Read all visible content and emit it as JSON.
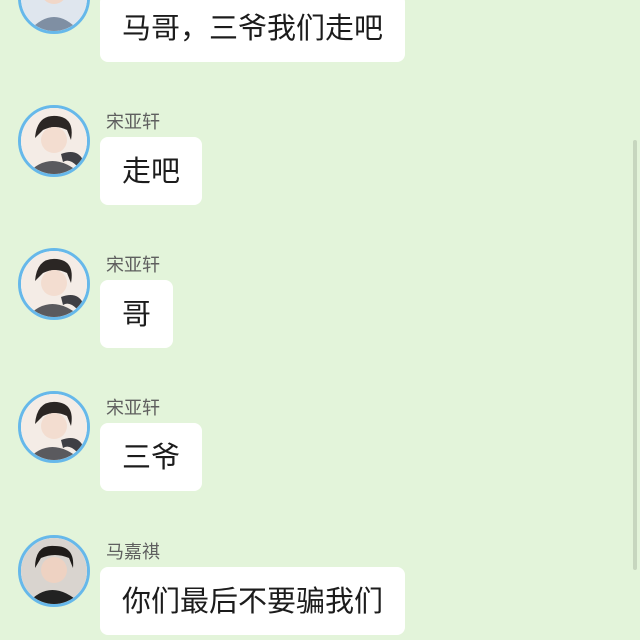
{
  "messages": [
    {
      "sender": "",
      "text": "马哥，三爷我们走吧",
      "avatar_icon": "person-avatar-icon"
    },
    {
      "sender": "宋亚轩",
      "text": "走吧",
      "avatar_icon": "person-avatar-icon"
    },
    {
      "sender": "宋亚轩",
      "text": "哥",
      "avatar_icon": "person-avatar-icon"
    },
    {
      "sender": "宋亚轩",
      "text": "三爷",
      "avatar_icon": "person-avatar-icon"
    },
    {
      "sender": "马嘉祺",
      "text": "你们最后不要骗我们",
      "avatar_icon": "person-avatar-icon"
    }
  ],
  "colors": {
    "background": "#e3f4da",
    "bubble": "#ffffff",
    "avatar_ring": "#66b8ea"
  }
}
